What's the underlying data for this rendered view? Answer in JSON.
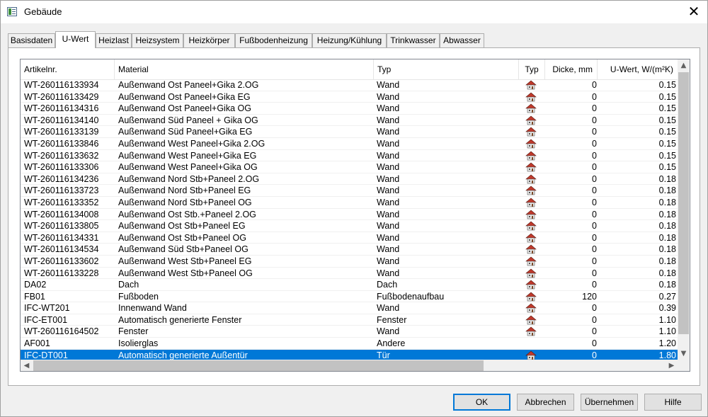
{
  "window": {
    "title": "Gebäude",
    "close_glyph": "✕"
  },
  "tabs": [
    {
      "label": "Basisdaten",
      "active": false
    },
    {
      "label": "U-Wert",
      "active": true
    },
    {
      "label": "Heizlast",
      "active": false
    },
    {
      "label": "Heizsystem",
      "active": false
    },
    {
      "label": "Heizkörper",
      "active": false
    },
    {
      "label": "Fußbodenheizung",
      "active": false
    },
    {
      "label": "Heizung/Kühlung",
      "active": false
    },
    {
      "label": "Trinkwasser",
      "active": false
    },
    {
      "label": "Abwasser",
      "active": false
    }
  ],
  "table": {
    "columns": {
      "article": "Artikelnr.",
      "material": "Material",
      "type": "Typ",
      "icon": "Typ",
      "thickness": "Dicke, mm",
      "uvalue": "U-Wert, W/(m²K)"
    },
    "rows": [
      {
        "article": "WT-260116133934",
        "material": "Außenwand Ost Paneel+Gika 2.OG",
        "type": "Wand",
        "icon": "wall-house-icon",
        "thickness": "0",
        "uvalue": "0.15"
      },
      {
        "article": "WT-260116133429",
        "material": "Außenwand Ost Paneel+Gika EG",
        "type": "Wand",
        "icon": "wall-house-icon",
        "thickness": "0",
        "uvalue": "0.15"
      },
      {
        "article": "WT-260116134316",
        "material": "Außenwand Ost Paneel+Gika OG",
        "type": "Wand",
        "icon": "wall-house-icon",
        "thickness": "0",
        "uvalue": "0.15"
      },
      {
        "article": "WT-260116134140",
        "material": "Außenwand Süd Paneel + Gika OG",
        "type": "Wand",
        "icon": "wall-house-icon",
        "thickness": "0",
        "uvalue": "0.15"
      },
      {
        "article": "WT-260116133139",
        "material": "Außenwand Süd Paneel+Gika EG",
        "type": "Wand",
        "icon": "wall-house-icon",
        "thickness": "0",
        "uvalue": "0.15"
      },
      {
        "article": "WT-260116133846",
        "material": "Außenwand West Paneel+Gika 2.OG",
        "type": "Wand",
        "icon": "wall-house-icon",
        "thickness": "0",
        "uvalue": "0.15"
      },
      {
        "article": "WT-260116133632",
        "material": "Außenwand West Paneel+Gika EG",
        "type": "Wand",
        "icon": "wall-house-icon",
        "thickness": "0",
        "uvalue": "0.15"
      },
      {
        "article": "WT-260116133306",
        "material": "Außenwand West Paneel+Gika OG",
        "type": "Wand",
        "icon": "wall-house-icon",
        "thickness": "0",
        "uvalue": "0.15"
      },
      {
        "article": "WT-260116134236",
        "material": "Außenwand Nord Stb+Paneel 2.OG",
        "type": "Wand",
        "icon": "wall-house-icon",
        "thickness": "0",
        "uvalue": "0.18"
      },
      {
        "article": "WT-260116133723",
        "material": "Außenwand Nord Stb+Paneel EG",
        "type": "Wand",
        "icon": "wall-house-icon",
        "thickness": "0",
        "uvalue": "0.18"
      },
      {
        "article": "WT-260116133352",
        "material": "Außenwand Nord Stb+Paneel OG",
        "type": "Wand",
        "icon": "wall-house-icon",
        "thickness": "0",
        "uvalue": "0.18"
      },
      {
        "article": "WT-260116134008",
        "material": "Außenwand Ost Stb.+Paneel 2.OG",
        "type": "Wand",
        "icon": "wall-house-icon",
        "thickness": "0",
        "uvalue": "0.18"
      },
      {
        "article": "WT-260116133805",
        "material": "Außenwand Ost Stb+Paneel EG",
        "type": "Wand",
        "icon": "wall-house-icon",
        "thickness": "0",
        "uvalue": "0.18"
      },
      {
        "article": "WT-260116134331",
        "material": "Außenwand Ost Stb+Paneel OG",
        "type": "Wand",
        "icon": "wall-house-icon",
        "thickness": "0",
        "uvalue": "0.18"
      },
      {
        "article": "WT-260116134534",
        "material": "Außenwand Süd Stb+Paneel OG",
        "type": "Wand",
        "icon": "wall-house-icon",
        "thickness": "0",
        "uvalue": "0.18"
      },
      {
        "article": "WT-260116133602",
        "material": "Außenwand West Stb+Paneel EG",
        "type": "Wand",
        "icon": "wall-house-icon",
        "thickness": "0",
        "uvalue": "0.18"
      },
      {
        "article": "WT-260116133228",
        "material": "Außenwand West Stb+Paneel OG",
        "type": "Wand",
        "icon": "wall-house-icon",
        "thickness": "0",
        "uvalue": "0.18"
      },
      {
        "article": "DA02",
        "material": "Dach",
        "type": "Dach",
        "icon": "roof-house-icon",
        "thickness": "0",
        "uvalue": "0.18"
      },
      {
        "article": "FB01",
        "material": "Fußboden",
        "type": "Fußbodenaufbau",
        "icon": "floor-house-icon",
        "thickness": "120",
        "uvalue": "0.27"
      },
      {
        "article": "IFC-WT201",
        "material": "Innenwand Wand",
        "type": "Wand",
        "icon": "wall-house-icon",
        "thickness": "0",
        "uvalue": "0.39"
      },
      {
        "article": "IFC-ET001",
        "material": "Automatisch generierte Fenster",
        "type": "Fenster",
        "icon": "window-house-icon",
        "thickness": "0",
        "uvalue": "1.10"
      },
      {
        "article": "WT-260116164502",
        "material": "Fenster",
        "type": "Wand",
        "icon": "wall-house-icon",
        "thickness": "0",
        "uvalue": "1.10"
      },
      {
        "article": "AF001",
        "material": "Isolierglas",
        "type": "Andere",
        "icon": "",
        "thickness": "0",
        "uvalue": "1.20"
      },
      {
        "article": "IFC-DT001",
        "material": "Automatisch generierte Außentür",
        "type": "Tür",
        "icon": "door-house-icon",
        "thickness": "0",
        "uvalue": "1.80",
        "selected": true
      }
    ]
  },
  "buttons": {
    "ok": "OK",
    "cancel": "Abbrechen",
    "apply": "Übernehmen",
    "help": "Hilfe"
  },
  "colors": {
    "selection": "#0078d7",
    "house_roof": "#c0392b"
  }
}
